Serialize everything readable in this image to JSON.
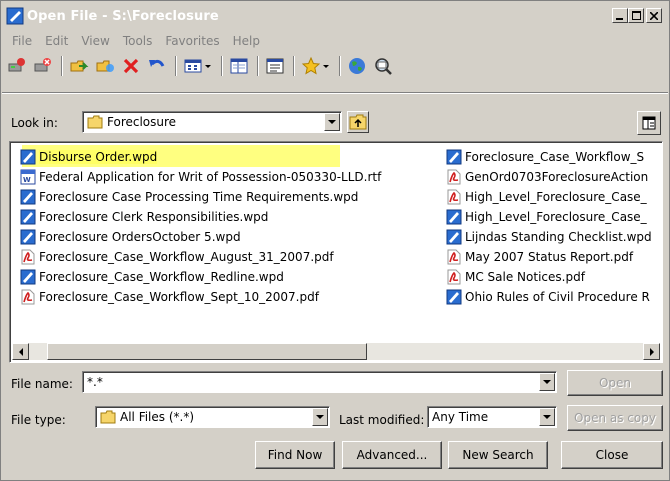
{
  "window": {
    "title": "Open File - S:\\Foreclosure"
  },
  "menu": [
    "File",
    "Edit",
    "View",
    "Tools",
    "Favorites",
    "Help"
  ],
  "toolbar_icons": [
    "map-drive-icon",
    "disconnect-drive-icon",
    "copy-icon",
    "move-icon",
    "delete-icon",
    "undo-icon",
    "views-icon",
    "properties-icon",
    "preview-icon",
    "favorites-icon",
    "internet-icon",
    "search-icon"
  ],
  "lookin": {
    "label": "Look in:",
    "value": "Foreclosure"
  },
  "files_left": [
    {
      "name": "Disburse Order.wpd",
      "type": "wpd",
      "selected": true
    },
    {
      "name": "Federal Application for Writ of Possession-050330-LLD.rtf",
      "type": "rtf"
    },
    {
      "name": "Foreclosure Case Processing Time Requirements.wpd",
      "type": "wpd"
    },
    {
      "name": "Foreclosure Clerk Responsibilities.wpd",
      "type": "wpd"
    },
    {
      "name": "Foreclosure OrdersOctober 5.wpd",
      "type": "wpd"
    },
    {
      "name": "Foreclosure_Case_Workflow_August_31_2007.pdf",
      "type": "pdf"
    },
    {
      "name": "Foreclosure_Case_Workflow_Redline.wpd",
      "type": "wpd"
    },
    {
      "name": "Foreclosure_Case_Workflow_Sept_10_2007.pdf",
      "type": "pdf"
    }
  ],
  "files_right": [
    {
      "name": "Foreclosure_Case_Workflow_S",
      "type": "wpd"
    },
    {
      "name": "GenOrd0703ForeclosureAction",
      "type": "pdf"
    },
    {
      "name": "High_Level_Foreclosure_Case_",
      "type": "pdf"
    },
    {
      "name": "High_Level_Foreclosure_Case_",
      "type": "wpd"
    },
    {
      "name": "Lijndas Standing Checklist.wpd",
      "type": "wpd"
    },
    {
      "name": "May 2007 Status Report.pdf",
      "type": "pdf"
    },
    {
      "name": "MC Sale Notices.pdf",
      "type": "pdf"
    },
    {
      "name": "Ohio Rules of Civil Procedure R",
      "type": "wpd"
    }
  ],
  "filename": {
    "label": "File name:",
    "value": "*.*"
  },
  "filetype": {
    "label": "File type:",
    "value": "All Files (*.*)"
  },
  "lastmodified": {
    "label": "Last modified:",
    "value": "Any Time"
  },
  "buttons": {
    "open": "Open",
    "open_as_copy": "Open as copy",
    "find_now": "Find Now",
    "advanced": "Advanced...",
    "new_search": "New Search",
    "close": "Close"
  },
  "colors": {
    "selection_highlight": "#ffff80",
    "face": "#d4d0c8",
    "pdf_red": "#cc2222",
    "wpd_blue": "#2266bb"
  }
}
